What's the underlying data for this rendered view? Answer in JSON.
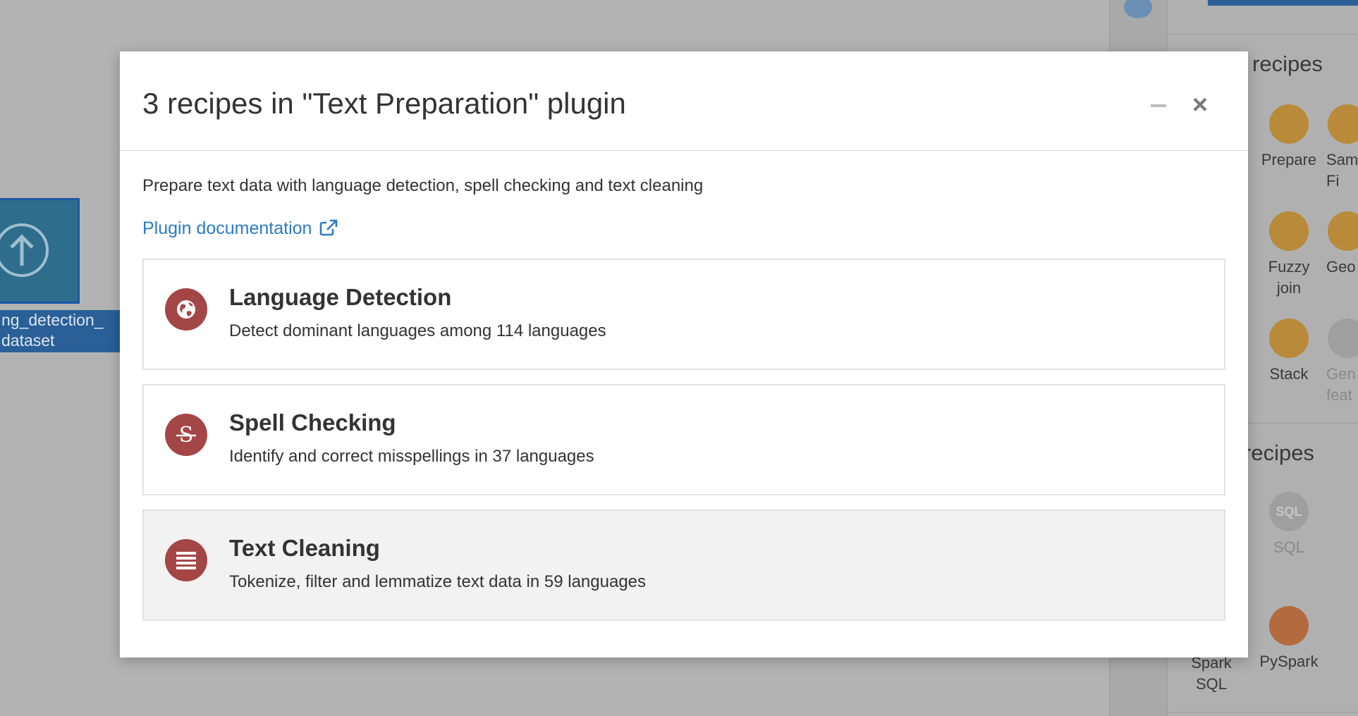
{
  "background": {
    "dataset_label": "ng_detection_\ndataset",
    "right_panel": {
      "section_1_title": "recipes",
      "section_2_title": "recipes",
      "recipes": [
        {
          "label": "Prepare",
          "icon": "broom-icon"
        },
        {
          "label": "Sam\nFi",
          "icon": "filter-icon"
        },
        {
          "label": "Fuzzy\njoin",
          "icon": "fuzzy-join-icon"
        },
        {
          "label": "Geo",
          "icon": "globe-icon"
        },
        {
          "label": "Stack",
          "icon": "stack-icon"
        },
        {
          "label": "Gen\nfeat",
          "icon": "generate-features-icon"
        },
        {
          "label": "SQL",
          "icon": "sql-icon",
          "icon_text": "SQL"
        },
        {
          "label": "Spark\nSQL",
          "icon": "spark-sql-icon"
        },
        {
          "label": "PySpark",
          "icon": "python-icon"
        }
      ]
    }
  },
  "modal": {
    "title": "3 recipes in \"Text Preparation\" plugin",
    "description": "Prepare text data with language detection, spell checking and text cleaning",
    "doc_link": "Plugin documentation",
    "recipes": [
      {
        "title": "Language Detection",
        "description": "Detect dominant languages among 114 languages",
        "icon": "globe-icon"
      },
      {
        "title": "Spell Checking",
        "description": "Identify and correct misspellings in 37 languages",
        "icon": "strikethrough-icon"
      },
      {
        "title": "Text Cleaning",
        "description": "Tokenize, filter and lemmatize text data in 59 languages",
        "icon": "align-justify-icon"
      }
    ]
  },
  "colors": {
    "accent_link": "#2b7bc3",
    "recipe_icon": "#a44646",
    "overlay": "#b3b3b3"
  }
}
